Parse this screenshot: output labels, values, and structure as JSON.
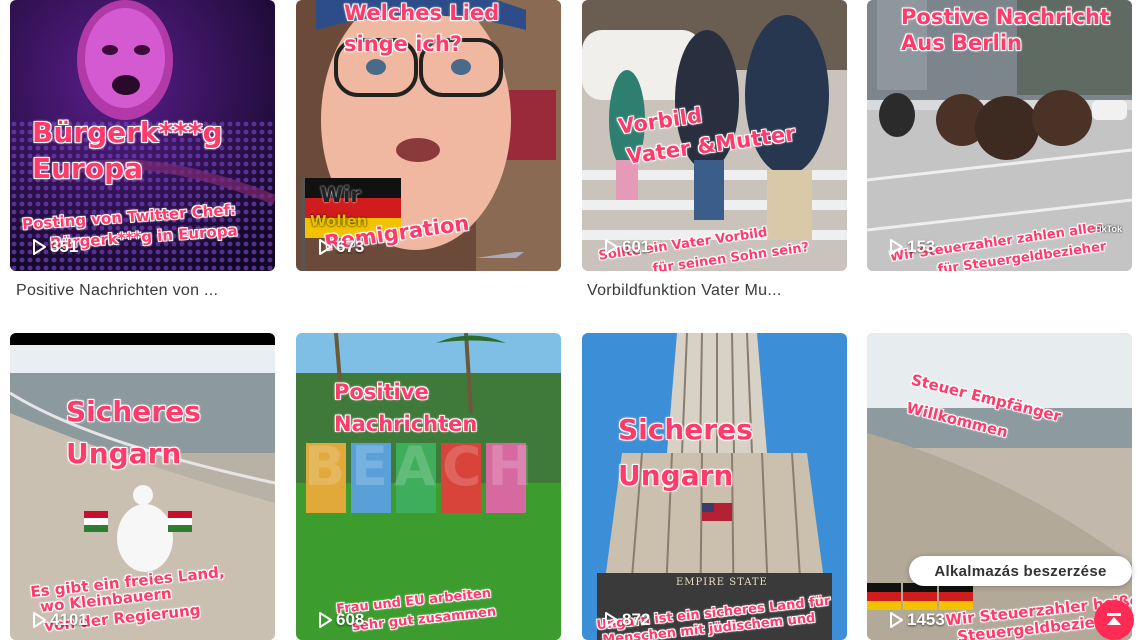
{
  "cards": [
    {
      "overlay": [
        "Bürgerk***g",
        "Europa"
      ],
      "sub": [
        "Posting von Twitter Chef:",
        "Bürgerk***g in Europa"
      ],
      "views": "351"
    },
    {
      "overlay": [
        "Welches Lied",
        "singe ich?"
      ],
      "sub": [
        "Wir",
        "Wollen",
        "Remigration"
      ],
      "views": "673"
    },
    {
      "overlay": [
        "Vorbild",
        "Vater &Mutter"
      ],
      "sub": [
        "Sollte ein Vater Vorbild",
        "für seinen Sohn sein?"
      ],
      "views": "601"
    },
    {
      "overlay": [
        "Postive Nachricht",
        "Aus Berlin"
      ],
      "sub": [
        "Wir Steuerzahler zahlen alles",
        "für Steuergeldbezieher"
      ],
      "views": "153"
    },
    {
      "overlay": [
        "Sicheres",
        "Ungarn"
      ],
      "sub": [
        "Es gibt ein freies Land,",
        "wo Kleinbauern",
        "von der Regierung"
      ],
      "views": "4101"
    },
    {
      "overlay": [
        "Positive",
        "Nachrichten"
      ],
      "sub": [
        "Frau und EU arbeiten",
        "sehr gut zusammen"
      ],
      "views": "608"
    },
    {
      "overlay": [
        "Sicheres",
        "Ungarn"
      ],
      "sub": [
        "Ungarn ist ein sicheres Land für",
        "Menschen mit jüdischem und"
      ],
      "views": "872"
    },
    {
      "overlay": [
        "Steuer Empfänger",
        "Willkommen"
      ],
      "sub": [
        "Wir Steuerzahler heißen die",
        "Steuergeldbezieher"
      ],
      "views": "1453"
    }
  ],
  "captions": {
    "c1": "Positive Nachrichten von ...",
    "c3": "Vorbildfunktion Vater Mu..."
  },
  "misc": {
    "beach_sign": "BEACH",
    "empire_sign": "EMPIRE STATE",
    "tiktok_mark": "TikTok",
    "app_button": "Alkalmazás beszerzése",
    "accent": "#fe2c55"
  }
}
